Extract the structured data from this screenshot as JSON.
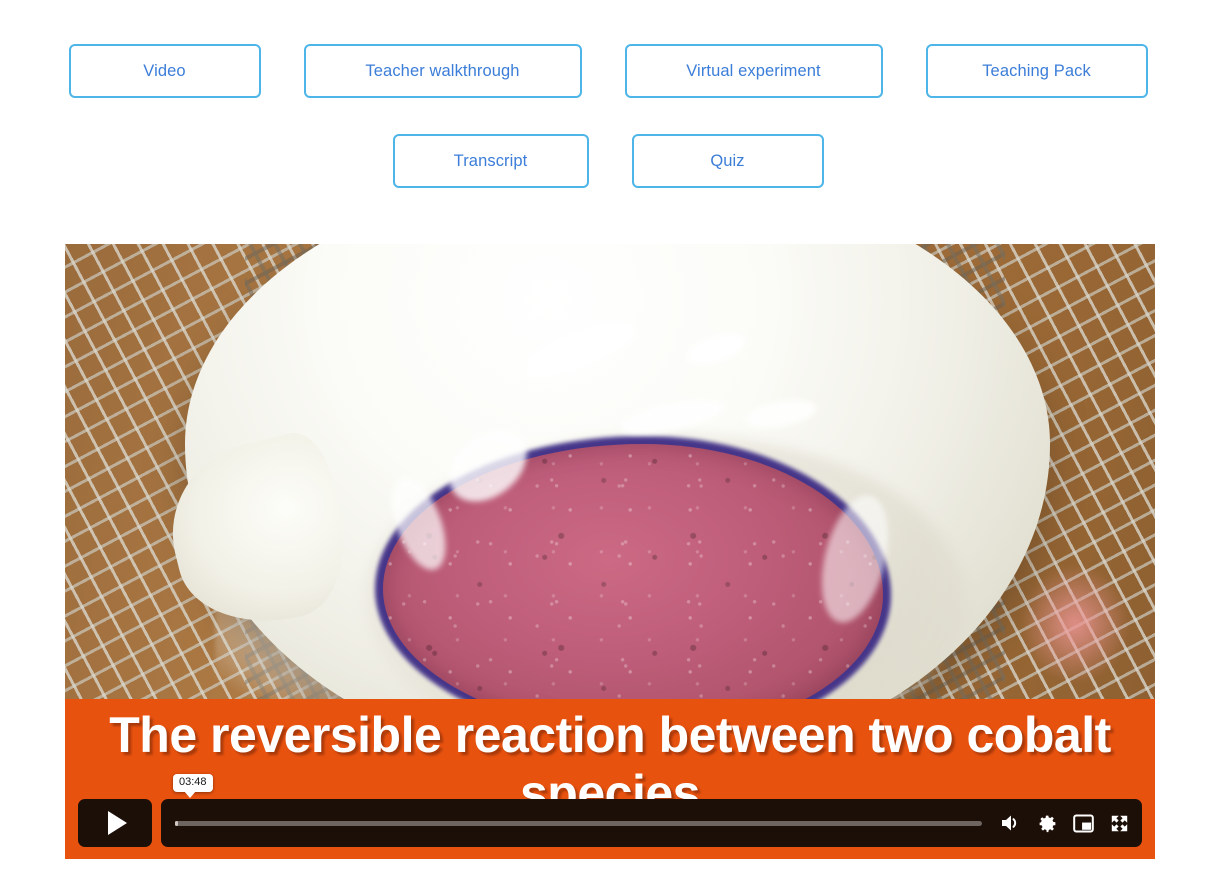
{
  "nav": {
    "rows": [
      [
        {
          "label": "Video",
          "width_class": "w-video",
          "name": "nav-button-video"
        },
        {
          "label": "Teacher walkthrough",
          "width_class": "w-teacher",
          "name": "nav-button-teacher-walkthrough"
        },
        {
          "label": "Virtual experiment",
          "width_class": "w-virtual",
          "name": "nav-button-virtual-experiment"
        },
        {
          "label": "Teaching Pack",
          "width_class": "w-pack",
          "name": "nav-button-teaching-pack"
        }
      ],
      [
        {
          "label": "Transcript",
          "width_class": "w-transcript",
          "name": "nav-button-transcript"
        },
        {
          "label": "Quiz",
          "width_class": "w-quiz",
          "name": "nav-button-quiz"
        }
      ]
    ]
  },
  "player": {
    "title": "The reversible reaction between two cobalt species",
    "time_tooltip": "03:48",
    "progress_percent": 0.4,
    "controls": {
      "play_label": "Play",
      "volume_label": "Volume",
      "settings_label": "Settings",
      "pip_label": "Picture in picture",
      "fullscreen_label": "Fullscreen"
    },
    "icons": [
      "play-icon",
      "volume-icon",
      "gear-icon",
      "picture-in-picture-icon",
      "fullscreen-icon"
    ],
    "scene_description": "White evaporating dish of pink and blue cobalt crystals on wire gauze"
  },
  "colors": {
    "chip_border": "#4db5e8",
    "chip_text": "#3b7dd8",
    "player_accent": "#e8520f",
    "control_bg": "#1c0f08",
    "crystal_pink": "#c05f7c",
    "crystal_blue": "#3e2d86"
  }
}
